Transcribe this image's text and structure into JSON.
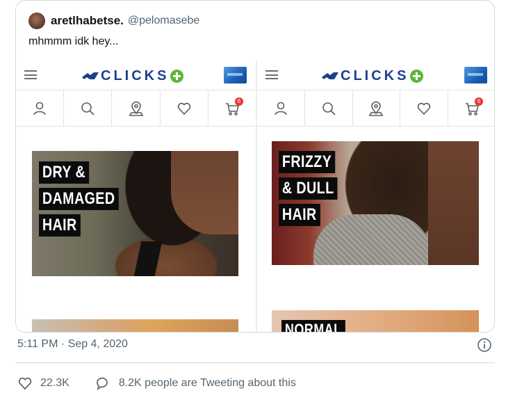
{
  "quoted_tweet": {
    "display_name": "aretlhabetse.",
    "handle": "@pelomasebe",
    "text": "mhmmm idk hey..."
  },
  "media": {
    "panels": [
      {
        "brand": "CLICKS",
        "cart_count": "6",
        "hero_labels": [
          "DRY &",
          "DAMAGED",
          "HAIR"
        ]
      },
      {
        "brand": "CLICKS",
        "cart_count": "6",
        "hero_labels": [
          "FRIZZY",
          "& DULL",
          "HAIR"
        ],
        "next_label": "NORMAL"
      }
    ]
  },
  "tweet": {
    "timestamp": "5:11 PM · Sep 4, 2020",
    "likes": "22.3K",
    "tweeting_about": "8.2K people are Tweeting about this"
  },
  "colors": {
    "brand_blue": "#1d3f8f",
    "brand_green": "#5fb53a",
    "secondary_text": "#536471"
  }
}
